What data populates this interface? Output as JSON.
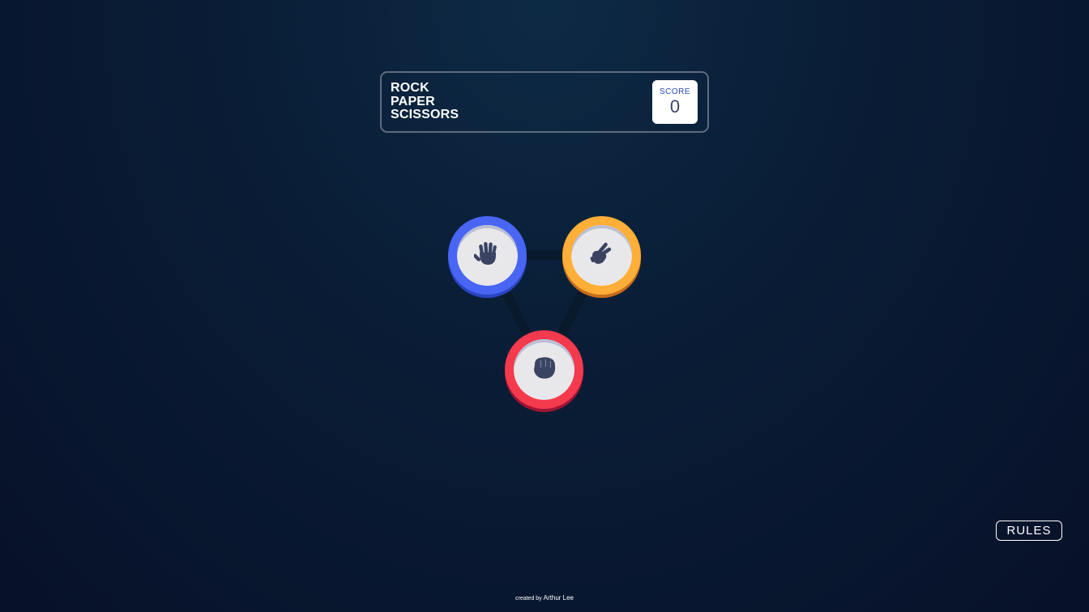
{
  "header": {
    "title_lines": [
      "ROCK",
      "PAPER",
      "SCISSORS"
    ],
    "score_label": "SCORE",
    "score_value": "0"
  },
  "tokens": [
    {
      "name": "paper",
      "icon": "hand-paper-icon",
      "color": "#4865f4"
    },
    {
      "name": "scissors",
      "icon": "hand-scissors-icon",
      "color": "#ffaf37"
    },
    {
      "name": "rock",
      "icon": "hand-rock-icon",
      "color": "#f53a4e"
    }
  ],
  "rules_button": "RULES",
  "footer": {
    "prefix": "created by",
    "author": "Arthur Lee"
  },
  "colors": {
    "background": "#0a1d36",
    "paper": "#4865f4",
    "scissors": "#ffaf37",
    "rock": "#f53a4e",
    "icon": "#3b4363"
  }
}
